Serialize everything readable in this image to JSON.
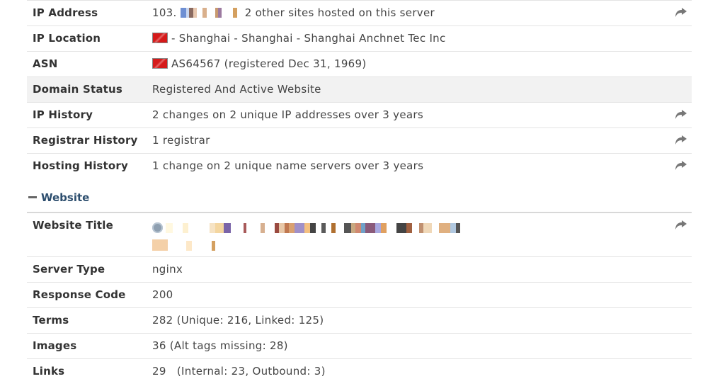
{
  "top_rows": [
    {
      "label": "IP Address",
      "value_prefix": "103.",
      "value_suffix": "2 other sites hosted on this server",
      "share": true
    },
    {
      "label": "IP Location",
      "value": "- Shanghai - Shanghai - Shanghai Anchnet Tec Inc",
      "flag": true
    },
    {
      "label": "ASN",
      "value": "AS64567 (registered Dec 31, 1969)",
      "flag": true
    },
    {
      "label": "Domain Status",
      "value": "Registered And Active Website",
      "shaded": true
    },
    {
      "label": "IP History",
      "value": "2 changes on 2 unique IP addresses over 3 years",
      "share": true
    },
    {
      "label": "Registrar History",
      "value": "1 registrar",
      "share": true
    },
    {
      "label": "Hosting History",
      "value": "1 change on 2 unique name servers over 3 years",
      "share": true
    }
  ],
  "section": {
    "title": "Website"
  },
  "website_rows": [
    {
      "label": "Website Title",
      "share": true
    },
    {
      "label": "Server Type",
      "value": "nginx"
    },
    {
      "label": "Response Code",
      "value": "200"
    },
    {
      "label": "Terms",
      "value": "282 (Unique: 216, Linked: 125)"
    },
    {
      "label": "Images",
      "value": "36 (Alt tags missing: 28)"
    },
    {
      "label": "Links",
      "value": "29   (Internal: 23, Outbound: 3)"
    }
  ],
  "colors": {
    "flag": "#d51a1a",
    "section_title": "#2d4e6e",
    "shaded_row": "#f2f2f2",
    "border": "#e3e3e3"
  },
  "icons": {
    "share": "share-arrow-icon",
    "flag": "china-flag-icon",
    "globe": "globe-icon",
    "collapse": "minus-icon"
  }
}
